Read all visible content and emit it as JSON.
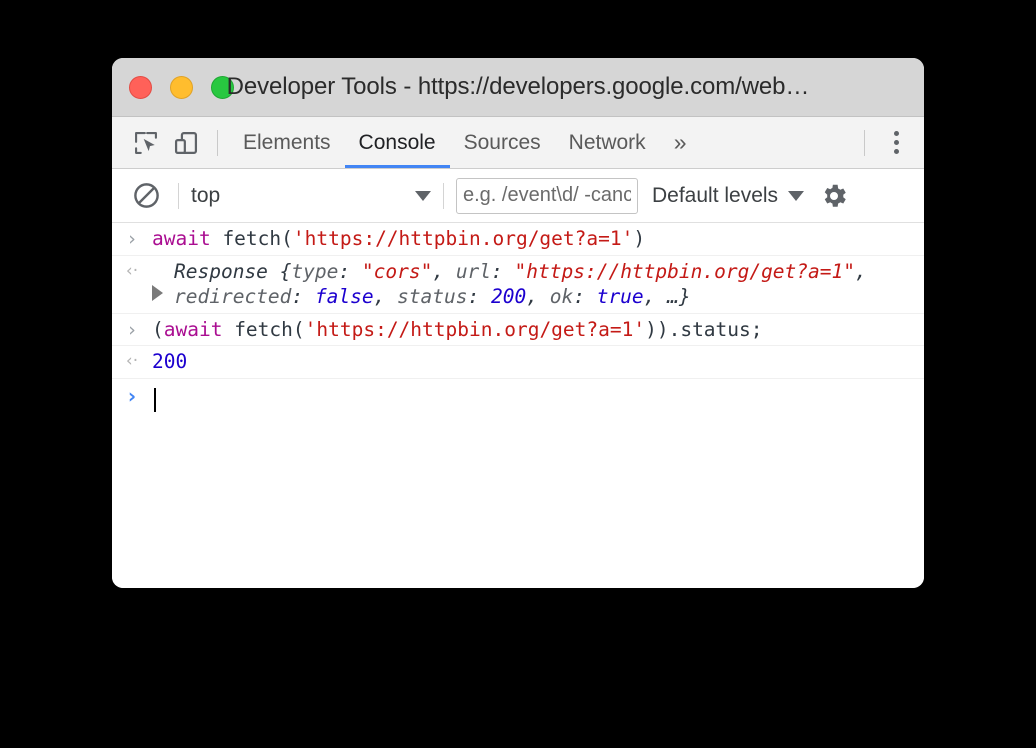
{
  "window": {
    "title": "Developer Tools - https://developers.google.com/web…",
    "traffic_lights": [
      {
        "name": "close",
        "color": "#ff6159"
      },
      {
        "name": "minimize",
        "color": "#ffbd2e"
      },
      {
        "name": "maximize",
        "color": "#28c840"
      }
    ]
  },
  "tabbar": {
    "inspect_icon": "inspect-element-icon",
    "device_icon": "device-toolbar-icon",
    "tabs": [
      {
        "label": "Elements",
        "active": false
      },
      {
        "label": "Console",
        "active": true
      },
      {
        "label": "Sources",
        "active": false
      },
      {
        "label": "Network",
        "active": false
      }
    ],
    "overflow_label": "»",
    "more_icon": "kebab-menu-icon",
    "active_underline_color": "#4285f4"
  },
  "filterbar": {
    "clear_icon": "clear-console-icon",
    "context": "top",
    "context_caret": "chevron-down-icon",
    "filter_placeholder": "e.g. /event\\d/ -cancelled",
    "filter_value": "",
    "levels_label": "Default levels",
    "levels_caret": "chevron-down-icon",
    "settings_icon": "gear-icon"
  },
  "console": {
    "entries": [
      {
        "kind": "input",
        "gutter": "›",
        "tokens": [
          {
            "t": "await",
            "c": "kw"
          },
          {
            "t": " fetch(",
            "c": "plain"
          },
          {
            "t": "'https://httpbin.org/get?a=1'",
            "c": "str"
          },
          {
            "t": ")",
            "c": "plain"
          }
        ]
      },
      {
        "kind": "output-object",
        "gutter": "‹·",
        "disclosure": "expand-triangle-icon",
        "tokens": [
          {
            "t": "Response ",
            "c": "cname"
          },
          {
            "t": "{",
            "c": "punc"
          },
          {
            "t": "type",
            "c": "prop"
          },
          {
            "t": ": ",
            "c": "punc"
          },
          {
            "t": "\"cors\"",
            "c": "str"
          },
          {
            "t": ", ",
            "c": "punc"
          },
          {
            "t": "url",
            "c": "prop"
          },
          {
            "t": ": ",
            "c": "punc"
          },
          {
            "t": "\"https://httpbin.org/get?a=1\"",
            "c": "str"
          },
          {
            "t": ", ",
            "c": "punc"
          },
          {
            "t": "redirected",
            "c": "prop"
          },
          {
            "t": ": ",
            "c": "punc"
          },
          {
            "t": "false",
            "c": "bool"
          },
          {
            "t": ", ",
            "c": "punc"
          },
          {
            "t": "status",
            "c": "prop"
          },
          {
            "t": ": ",
            "c": "punc"
          },
          {
            "t": "200",
            "c": "num"
          },
          {
            "t": ", ",
            "c": "punc"
          },
          {
            "t": "ok",
            "c": "prop"
          },
          {
            "t": ": ",
            "c": "punc"
          },
          {
            "t": "true",
            "c": "bool"
          },
          {
            "t": ", …}",
            "c": "punc"
          }
        ]
      },
      {
        "kind": "input",
        "gutter": "›",
        "tokens": [
          {
            "t": "(",
            "c": "plain"
          },
          {
            "t": "await",
            "c": "kw"
          },
          {
            "t": " fetch(",
            "c": "plain"
          },
          {
            "t": "'https://httpbin.org/get?a=1'",
            "c": "str"
          },
          {
            "t": ")).status;",
            "c": "plain"
          }
        ]
      },
      {
        "kind": "output",
        "gutter": "‹·",
        "tokens": [
          {
            "t": "200",
            "c": "num"
          }
        ]
      }
    ],
    "prompt": {
      "gutter": "›",
      "value": "",
      "cursor": true
    }
  }
}
